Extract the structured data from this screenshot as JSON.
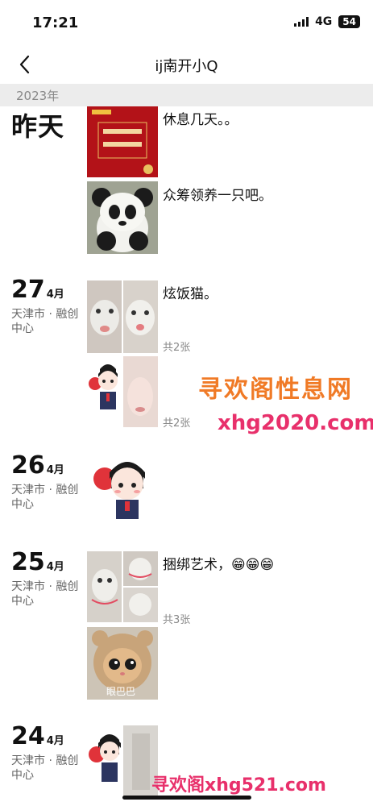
{
  "status": {
    "time": "17:21",
    "network": "4G",
    "battery": "54"
  },
  "nav": {
    "title": "ij南开小Q"
  },
  "year": "2023年",
  "groups": [
    {
      "date": "昨天",
      "posts": [
        {
          "text": "休息几天。。"
        },
        {
          "text": "众筹领养一只吧。"
        }
      ]
    },
    {
      "day": "27",
      "month": "4月",
      "location": "天津市 · 融创中心",
      "posts": [
        {
          "text": "炫饭猫。",
          "count": "共2张"
        },
        {
          "count": "共2张"
        }
      ]
    },
    {
      "day": "26",
      "month": "4月",
      "location": "天津市 · 融创中心"
    },
    {
      "day": "25",
      "month": "4月",
      "location": "天津市 · 融创中心",
      "posts": [
        {
          "text": "捆绑艺术，😁😁😁",
          "count": "共3张"
        },
        {
          "caption": "眼巴巴"
        }
      ]
    },
    {
      "day": "24",
      "month": "4月",
      "location": "天津市 · 融创中心"
    }
  ],
  "watermarks": {
    "w1": "寻欢阁性息网",
    "w2": "xhg2020.com",
    "w3": "寻欢阁xhg521.com"
  },
  "colors": {
    "year_strip": "#ececec",
    "red_card": "#b31218"
  }
}
